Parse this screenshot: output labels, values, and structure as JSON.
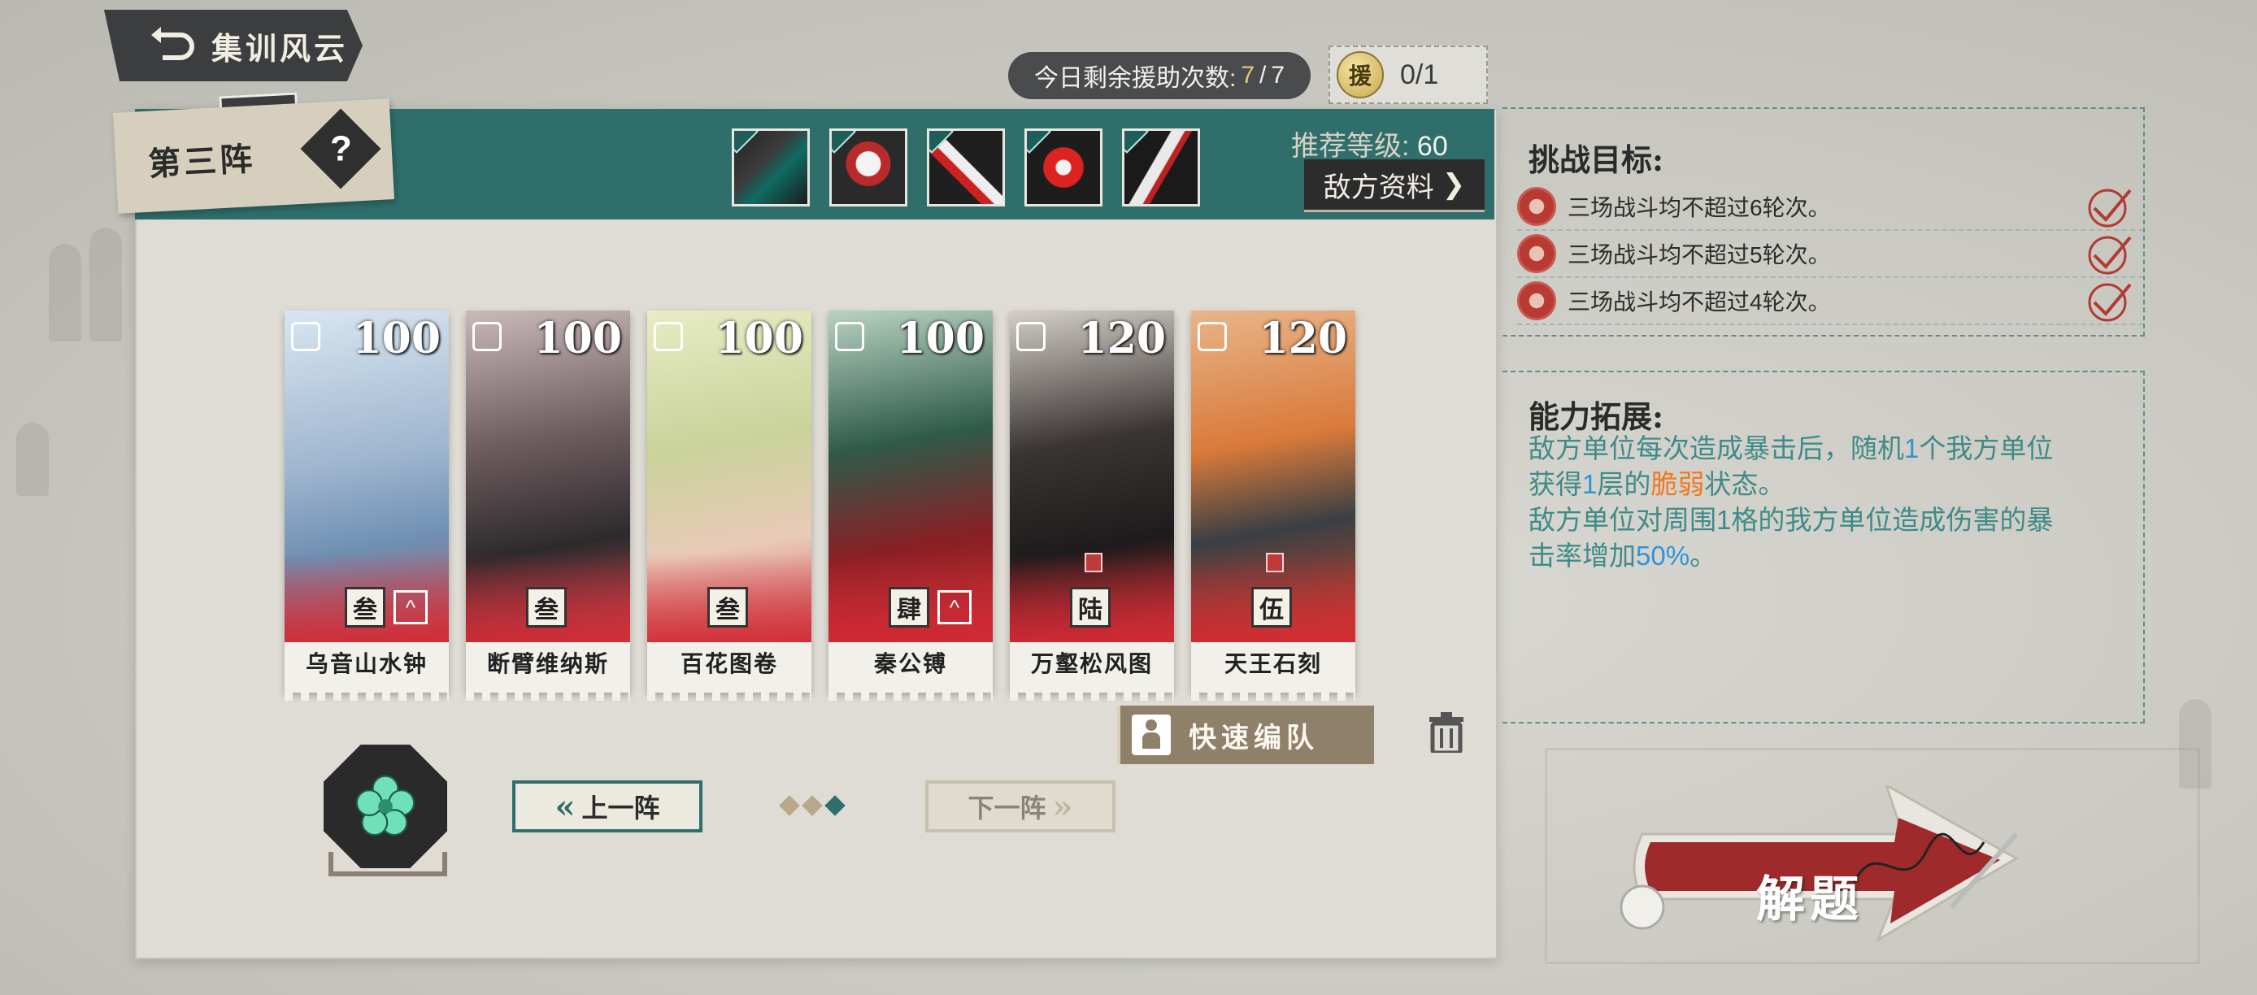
{
  "header": {
    "title": "集训风云",
    "assist_label": "今日剩余援助次数: ",
    "assist_remaining": "7",
    "assist_separator": "/",
    "assist_total": "7",
    "assist_badge_char": "援",
    "assist_used": "0/1"
  },
  "formation": {
    "name": "第三阵",
    "help_symbol": "?",
    "recommended_label": "推荐等级:",
    "recommended_level": "60",
    "enemy_info_label": "敌方资料",
    "enemies": [
      {
        "icon": "enemy-portrait-1"
      },
      {
        "icon": "enemy-portrait-2"
      },
      {
        "icon": "enemy-portrait-3"
      },
      {
        "icon": "enemy-portrait-4"
      },
      {
        "icon": "enemy-portrait-5"
      }
    ]
  },
  "heroes": [
    {
      "name": "乌音山水钟",
      "cost": "100",
      "rank": "叁",
      "color": "#9fb6cf"
    },
    {
      "name": "断臂维纳斯",
      "cost": "100",
      "rank": "叁",
      "color": "#6c5b5e"
    },
    {
      "name": "百花图卷",
      "cost": "100",
      "rank": "叁",
      "color": "#c9d39a"
    },
    {
      "name": "秦公镈",
      "cost": "100",
      "rank": "肆",
      "color": "#2f5a4a"
    },
    {
      "name": "万壑松风图",
      "cost": "120",
      "rank": "陆",
      "color": "#3a3534"
    },
    {
      "name": "天王石刻",
      "cost": "120",
      "rank": "伍",
      "color": "#d97a3a"
    }
  ],
  "controls": {
    "quick_team_label": "快速编队",
    "prev_label": "上一阵",
    "next_label": "下一阵"
  },
  "challenge": {
    "title": "挑战目标:",
    "goals": [
      "三场战斗均不超过6轮次。",
      "三场战斗均不超过5轮次。",
      "三场战斗均不超过4轮次。"
    ]
  },
  "ability": {
    "title": "能力拓展:",
    "line1_a": "敌方单位每次造成暴击后，随机",
    "line1_num": "1",
    "line1_b": "个我方单位",
    "line2_a": "获得",
    "line2_num": "1",
    "line2_b": "层的",
    "line2_status": "脆弱",
    "line2_c": "状态。",
    "line3": "敌方单位对周围1格的我方单位造成伤害的暴",
    "line4_a": "击率增加",
    "line4_pct": "50%",
    "line4_b": "。"
  },
  "solve": {
    "label": "解题"
  },
  "colors": {
    "teal": "#2f6e6b",
    "ability_text": "#3e8b88",
    "highlight_blue": "#2f94d6",
    "highlight_orange": "#f07a22",
    "solve_red": "#9e2a2b"
  }
}
